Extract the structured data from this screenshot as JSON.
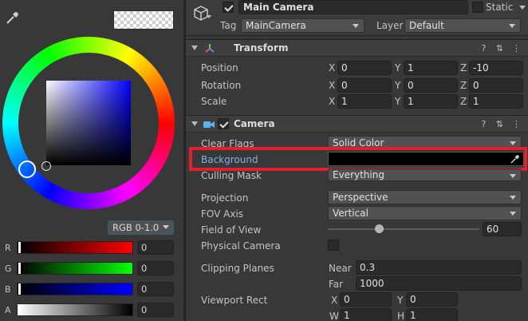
{
  "color_picker": {
    "mode": "RGB 0-1.0",
    "channels": [
      {
        "label": "R",
        "value": "0"
      },
      {
        "label": "G",
        "value": "0"
      },
      {
        "label": "B",
        "value": "0"
      },
      {
        "label": "A",
        "value": "0"
      }
    ],
    "colors": {
      "r": "#ff0000",
      "g": "#00ff00",
      "b": "#0000ff"
    }
  },
  "gameobject": {
    "name": "Main Camera",
    "static_label": "Static",
    "tag_label": "Tag",
    "tag_value": "MainCamera",
    "layer_label": "Layer",
    "layer_value": "Default"
  },
  "transform": {
    "title": "Transform",
    "rows": [
      {
        "label": "Position",
        "x": "0",
        "y": "1",
        "z": "-10"
      },
      {
        "label": "Rotation",
        "x": "0",
        "y": "0",
        "z": "0"
      },
      {
        "label": "Scale",
        "x": "1",
        "y": "1",
        "z": "1"
      }
    ],
    "axes": {
      "x": "X",
      "y": "Y",
      "z": "Z"
    }
  },
  "camera": {
    "title": "Camera",
    "clear_flags_label": "Clear Flags",
    "clear_flags_value": "Solid Color",
    "background_label": "Background",
    "background_color": "#000000",
    "culling_label": "Culling Mask",
    "culling_value": "Everything",
    "projection_label": "Projection",
    "projection_value": "Perspective",
    "fov_axis_label": "FOV Axis",
    "fov_axis_value": "Vertical",
    "fov_label": "Field of View",
    "fov_value": "60",
    "physical_label": "Physical Camera",
    "clipping_label": "Clipping Planes",
    "near_label": "Near",
    "near_value": "0.3",
    "far_label": "Far",
    "far_value": "1000",
    "viewport_label": "Viewport Rect",
    "vp_x_label": "X",
    "vp_x": "0",
    "vp_y_label": "Y",
    "vp_y": "0",
    "vp_w_label": "W",
    "vp_w": "1",
    "vp_h_label": "H",
    "vp_h": "1"
  },
  "colors": {
    "highlight": "#e0202e",
    "accent_label": "#7fb2e6"
  }
}
